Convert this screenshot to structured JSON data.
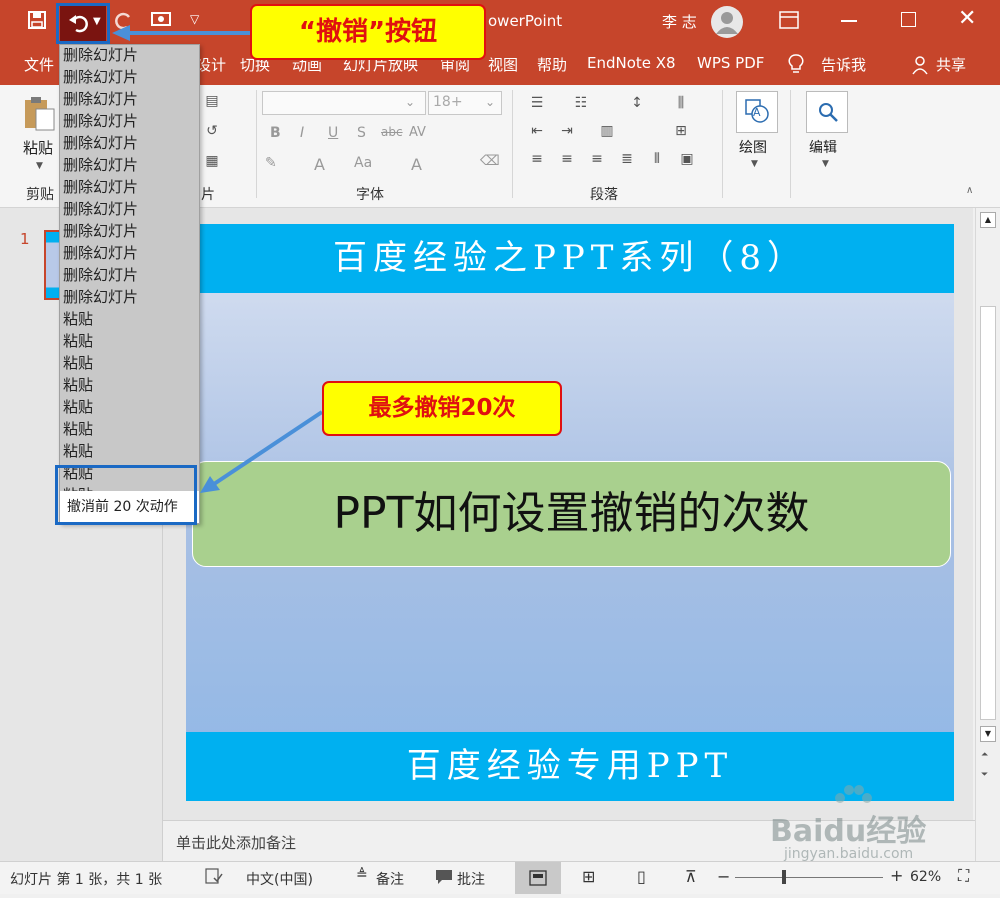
{
  "app": {
    "title_partial": "owerPoint",
    "user": "李 志"
  },
  "ribbon_tabs": [
    "文件",
    "设计",
    "切换",
    "动画",
    "幻灯片放映",
    "审阅",
    "视图",
    "帮助",
    "EndNote X8",
    "WPS PDF",
    "告诉我",
    "共享"
  ],
  "ribbon": {
    "paste": "粘贴",
    "clipboard": "剪贴",
    "slides_group_partial": "片",
    "font_size": "18+",
    "font_group": "字体",
    "paragraph_group": "段落",
    "drawing": "绘图",
    "editing": "编辑",
    "bold": "B",
    "italic": "I",
    "underline": "U",
    "shadow": "S",
    "strike": "abc",
    "spacing": "AV",
    "font_color": "A",
    "font_big": "A",
    "font_case": "Aa"
  },
  "undo_list": {
    "items": [
      "删除幻灯片",
      "删除幻灯片",
      "删除幻灯片",
      "删除幻灯片",
      "删除幻灯片",
      "删除幻灯片",
      "删除幻灯片",
      "删除幻灯片",
      "删除幻灯片",
      "删除幻灯片",
      "删除幻灯片",
      "删除幻灯片",
      "粘贴",
      "粘贴",
      "粘贴",
      "粘贴",
      "粘贴",
      "粘贴",
      "粘贴",
      "粘贴",
      "粘贴"
    ],
    "footer": "撤消前 20 次动作"
  },
  "annotations": {
    "undo_button": "“撤销”按钮",
    "max_undo": "最多撤销20次"
  },
  "thumbnail": {
    "number": "1"
  },
  "slide": {
    "header": "百度经验之PPT系列（8）",
    "body": "PPT如何设置撤销的次数",
    "footer": "百度经验专用PPT"
  },
  "notes": {
    "placeholder": "单击此处添加备注"
  },
  "status": {
    "slide_info": "幻灯片 第 1 张，共 1 张",
    "language": "中文(中国)",
    "notes": "备注",
    "comments": "批注",
    "zoom": "62%"
  },
  "watermark": {
    "brand": "Baidu经验",
    "url": "jingyan.baidu.com"
  },
  "colors": {
    "accent": "#c6452b",
    "slide_band": "#00b0f0",
    "textbox": "#a9d08e",
    "callout_fill": "#ffff00",
    "callout_text": "#e01010",
    "highlight_box": "#1a69c4"
  }
}
